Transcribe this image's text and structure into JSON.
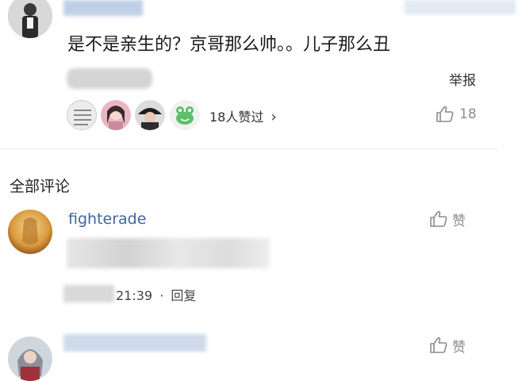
{
  "top_comment": {
    "text": "是不是亲生的？京哥那么帅。。儿子那么丑",
    "report_label": "举报",
    "likers_label": "18人赞过",
    "chevron": "›",
    "like_count": "18",
    "like_icon": "thumbs-up-icon"
  },
  "section": {
    "title": "全部评论"
  },
  "comments": [
    {
      "username": "fighterade",
      "time": "21:39",
      "separator": "·",
      "reply_label": "回复",
      "like_label": "赞"
    },
    {
      "like_label": "赞"
    }
  ],
  "colors": {
    "link": "#3f66a3",
    "muted": "#8c8c8c",
    "divider": "#ececec"
  }
}
